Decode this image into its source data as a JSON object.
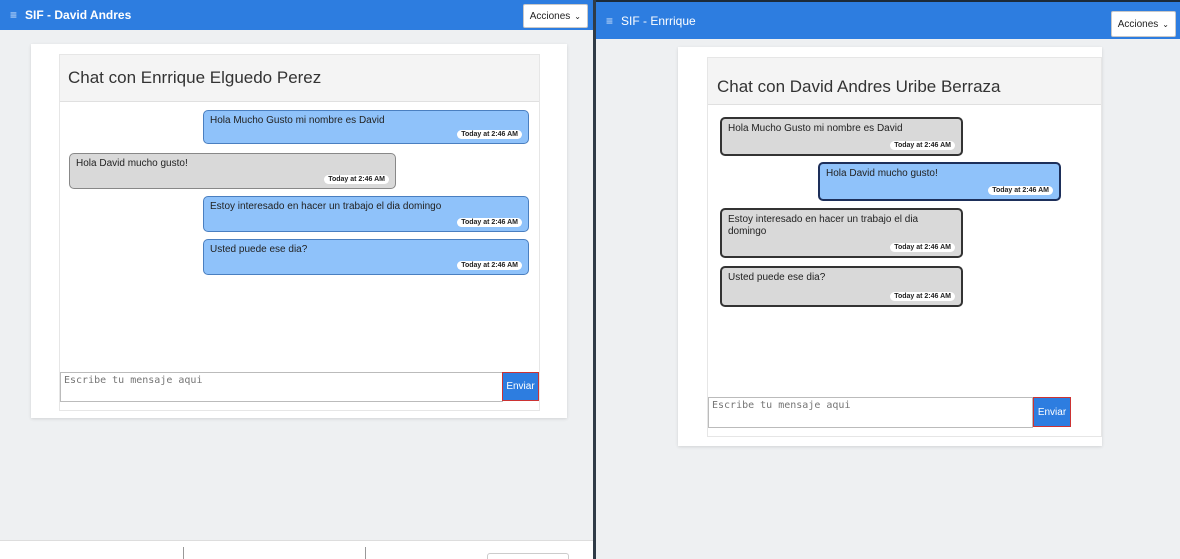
{
  "left": {
    "app_title": "SIF - David Andres",
    "actions_label": "Acciones",
    "chat_title": "Chat con Enrrique Elguedo Perez",
    "messages": [
      {
        "text": "Hola Mucho Gusto mi nombre es David",
        "time": "Today at 2:46 AM",
        "side": "sent"
      },
      {
        "text": "Hola David mucho gusto!",
        "time": "Today at 2:46 AM",
        "side": "received"
      },
      {
        "text": "Estoy interesado en hacer un trabajo el dia domingo",
        "time": "Today at 2:46 AM",
        "side": "sent"
      },
      {
        "text": "Usted puede ese dia?",
        "time": "Today at 2:46 AM",
        "side": "sent"
      }
    ],
    "input_placeholder": "Escribe tu mensaje aqui",
    "send_label": "Enviar"
  },
  "right": {
    "app_title": "SIF - Enrrique",
    "actions_label": "Acciones",
    "chat_title": "Chat con David Andres Uribe Berraza",
    "messages": [
      {
        "text": "Hola Mucho Gusto mi nombre es David",
        "time": "Today at 2:46 AM",
        "side": "received"
      },
      {
        "text": "Hola David mucho gusto!",
        "time": "Today at 2:46 AM",
        "side": "sent"
      },
      {
        "text": "Estoy interesado en hacer un trabajo el dia domingo",
        "time": "Today at 2:46 AM",
        "side": "received"
      },
      {
        "text": "Usted puede ese dia?",
        "time": "Today at 2:46 AM",
        "side": "received"
      }
    ],
    "input_placeholder": "Escribe tu mensaje aqui",
    "send_label": "Enviar"
  },
  "icons": {
    "menu": "hamburger-icon",
    "chevron": "chevron-down-icon"
  },
  "colors": {
    "topbar": "#2d7de0",
    "sent_bubble": "#8fc2fa",
    "received_bubble": "#d9d9d9",
    "send_button": "#2d7de0"
  }
}
